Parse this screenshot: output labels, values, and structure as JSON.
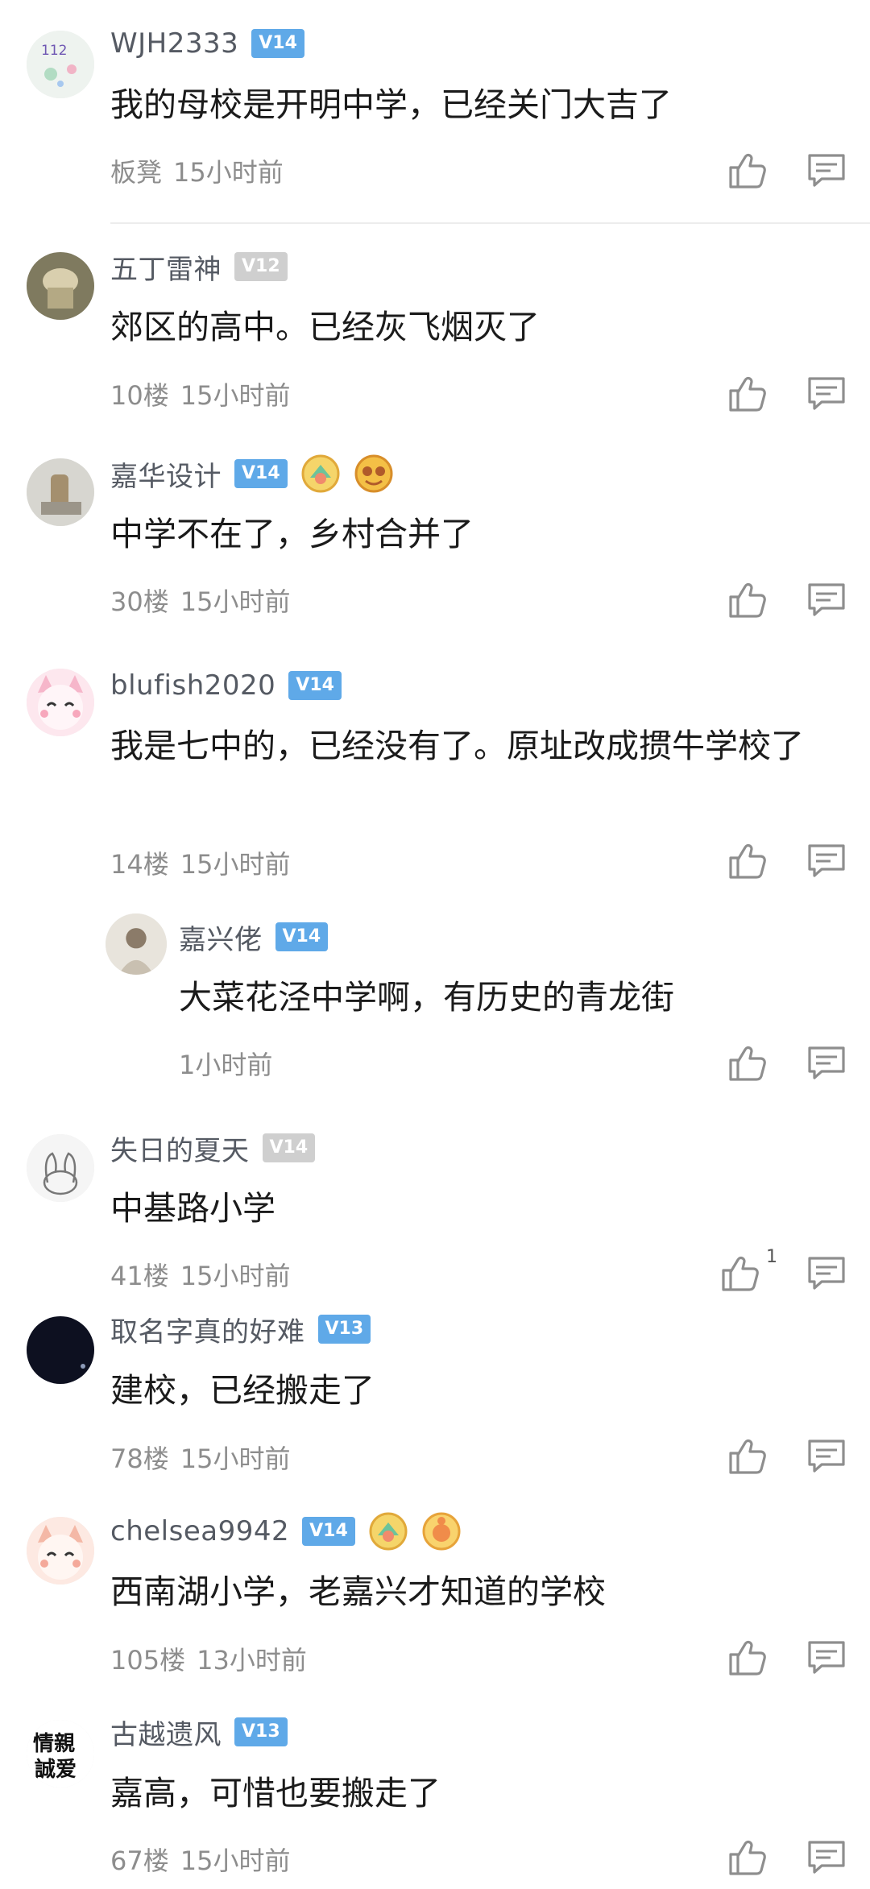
{
  "comments": [
    {
      "username": "WJH2333",
      "level": "V14",
      "level_color": "#5fa9e8",
      "text": "我的母校是开明中学，已经关门大吉了",
      "floor": "板凳",
      "time": "15小时前"
    },
    {
      "username": "五丁雷神",
      "level": "V12",
      "level_color": "#cfcfcf",
      "text": "郊区的高中。已经灰飞烟灭了",
      "floor": "10楼",
      "time": "15小时前"
    },
    {
      "username": "嘉华设计",
      "level": "V14",
      "level_color": "#5fa9e8",
      "text": "中学不在了，乡村合并了",
      "floor": "30楼",
      "time": "15小时前"
    },
    {
      "username": "blufish2020",
      "level": "V14",
      "level_color": "#5fa9e8",
      "text": "我是七中的，已经没有了。原址改成掼牛学校了",
      "floor": "14楼",
      "time": "15小时前"
    },
    {
      "username": "嘉兴佬",
      "level": "V14",
      "level_color": "#5fa9e8",
      "text": "大菜花泾中学啊，有历史的青龙街",
      "floor": "",
      "time": "1小时前"
    },
    {
      "username": "失日的夏天",
      "level": "V14",
      "level_color": "#cfcfcf",
      "text": "中基路小学",
      "floor": "41楼",
      "time": "15小时前",
      "like_count": "1"
    },
    {
      "username": "取名字真的好难",
      "level": "V13",
      "level_color": "#5fa9e8",
      "text": "建校，已经搬走了",
      "floor": "78楼",
      "time": "15小时前"
    },
    {
      "username": "chelsea9942",
      "level": "V14",
      "level_color": "#5fa9e8",
      "text": "西南湖小学，老嘉兴才知道的学校",
      "floor": "105楼",
      "time": "13小时前"
    },
    {
      "username": "古越遗风",
      "level": "V13",
      "level_color": "#5fa9e8",
      "text": "嘉高，可惜也要搬走了",
      "floor": "67楼",
      "time": "15小时前"
    }
  ],
  "avatar_texts": {
    "avatar_0": "112",
    "avatar_8_lines": [
      "情親",
      "誠爱"
    ]
  },
  "icons": {
    "like": "thumbs-up-icon",
    "reply": "comment-icon",
    "medal": "medal-icon"
  }
}
